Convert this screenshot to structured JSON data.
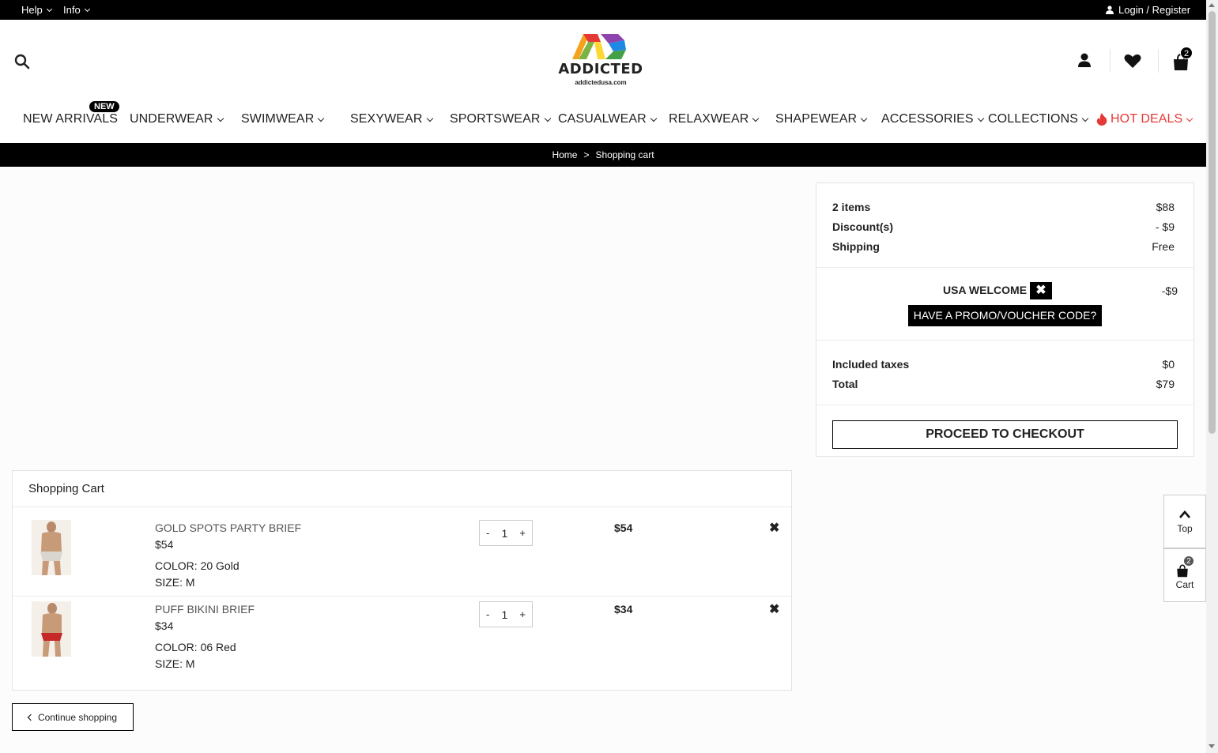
{
  "topbar": {
    "help_label": "Help",
    "info_label": "Info",
    "login_label": "Login / Register"
  },
  "header": {
    "logo_text": "ADDICTED",
    "logo_sub": "addictedusa.com",
    "cart_count": "2"
  },
  "nav": {
    "new_badge": "NEW",
    "items": [
      {
        "label": "NEW ARRIVALS"
      },
      {
        "label": "UNDERWEAR"
      },
      {
        "label": "SWIMWEAR"
      },
      {
        "label": "SEXYWEAR"
      },
      {
        "label": "SPORTSWEAR"
      },
      {
        "label": "CASUALWEAR"
      },
      {
        "label": "RELAXWEAR"
      },
      {
        "label": "SHAPEWEAR"
      },
      {
        "label": "ACCESSORIES"
      },
      {
        "label": "COLLECTIONS"
      },
      {
        "label": "HOT DEALS"
      }
    ]
  },
  "breadcrumb": {
    "home": "Home",
    "separator": ">",
    "current": "Shopping cart"
  },
  "summary": {
    "items_label": "2 items",
    "items_value": "$88",
    "discount_label": "Discount(s)",
    "discount_value": "- $9",
    "shipping_label": "Shipping",
    "shipping_value": "Free",
    "voucher_name": "USA WELCOME",
    "voucher_amount": "-$9",
    "promo_button": "HAVE A PROMO/VOUCHER CODE?",
    "taxes_label": "Included taxes",
    "taxes_value": "$0",
    "total_label": "Total",
    "total_value": "$79",
    "checkout_button": "PROCEED TO CHECKOUT"
  },
  "cart": {
    "title": "Shopping Cart",
    "items": [
      {
        "name": "GOLD SPOTS PARTY BRIEF",
        "price": "$54",
        "color": "COLOR: 20 Gold",
        "size": "SIZE: M",
        "quantity": "1",
        "total": "$54",
        "swatch": "#d9d6cf"
      },
      {
        "name": "PUFF BIKINI BRIEF",
        "price": "$34",
        "color": "COLOR: 06 Red",
        "size": "SIZE: M",
        "quantity": "1",
        "total": "$34",
        "swatch": "#c62828"
      }
    ],
    "qty_minus": "-",
    "qty_plus": "+",
    "continue_label": "Continue shopping"
  },
  "floating": {
    "top_label": "Top",
    "cart_label": "Cart",
    "cart_count": "2"
  },
  "colors": {
    "hot_deals": "#e53935",
    "black": "#000000"
  }
}
